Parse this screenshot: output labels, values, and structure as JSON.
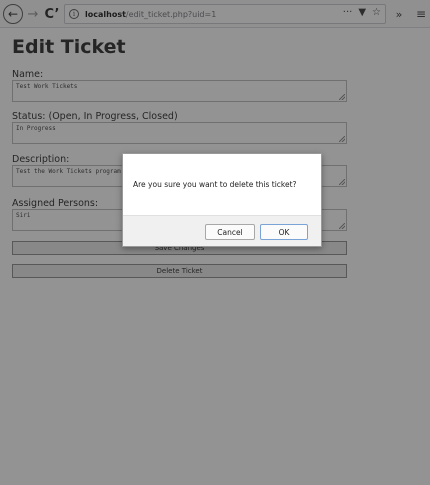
{
  "browser": {
    "url_host": "localhost",
    "url_path": "/edit_ticket.php?uid=1",
    "icons": {
      "back": "arrow-left",
      "forward": "arrow-right",
      "reload": "reload",
      "info": "info-circle",
      "more": "ellipsis",
      "pocket": "pocket",
      "bookmark": "star",
      "overflow": "double-chevron",
      "menu": "hamburger"
    }
  },
  "page": {
    "title": "Edit Ticket",
    "fields": {
      "name_label": "Name:",
      "name_value": "Test Work Tickets",
      "status_label": "Status: (Open, In Progress, Closed)",
      "status_value": "In Progress",
      "description_label": "Description:",
      "description_value": "Test the Work Tickets program",
      "assigned_label": "Assigned Persons:",
      "assigned_value": "Siri"
    },
    "buttons": {
      "save": "Save Changes",
      "delete": "Delete Ticket"
    }
  },
  "dialog": {
    "message": "Are you sure you want to delete this ticket?",
    "cancel_label": "Cancel",
    "ok_label": "OK"
  }
}
